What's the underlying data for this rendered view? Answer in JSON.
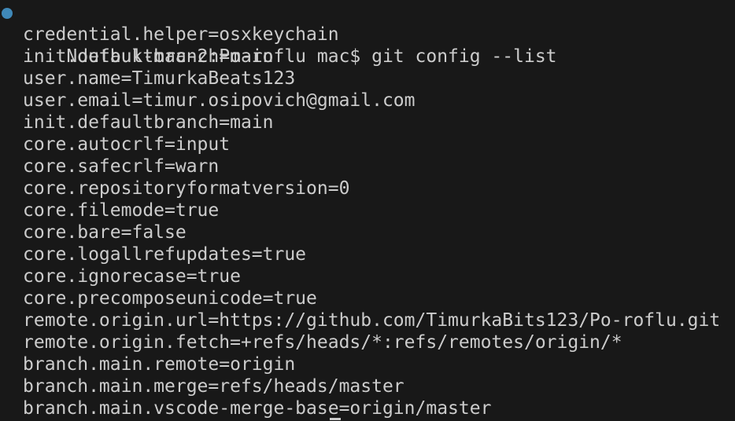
{
  "terminal": {
    "prompt": "Noutbuk-mac-2:Po-roflu mac$ git config --list",
    "output": [
      "credential.helper=osxkeychain",
      "init.defaultbranch=main",
      "user.name=TimurkaBeats123",
      "user.email=timur.osipovich@gmail.com",
      "init.defaultbranch=main",
      "core.autocrlf=input",
      "core.safecrlf=warn",
      "core.repositoryformatversion=0",
      "core.filemode=true",
      "core.bare=false",
      "core.logallrefupdates=true",
      "core.ignorecase=true",
      "core.precomposeunicode=true",
      "remote.origin.url=https://github.com/TimurkaBits123/Po-roflu.git",
      "remote.origin.fetch=+refs/heads/*:refs/remotes/origin/*",
      "branch.main.remote=origin",
      "branch.main.merge=refs/heads/master",
      "branch.main.vscode-merge-base=origin/master"
    ]
  },
  "colors": {
    "background": "#181818",
    "text": "#cccccc",
    "status_dot": "#3f88b8"
  },
  "icons": {
    "status": "command-status-dot-icon"
  }
}
